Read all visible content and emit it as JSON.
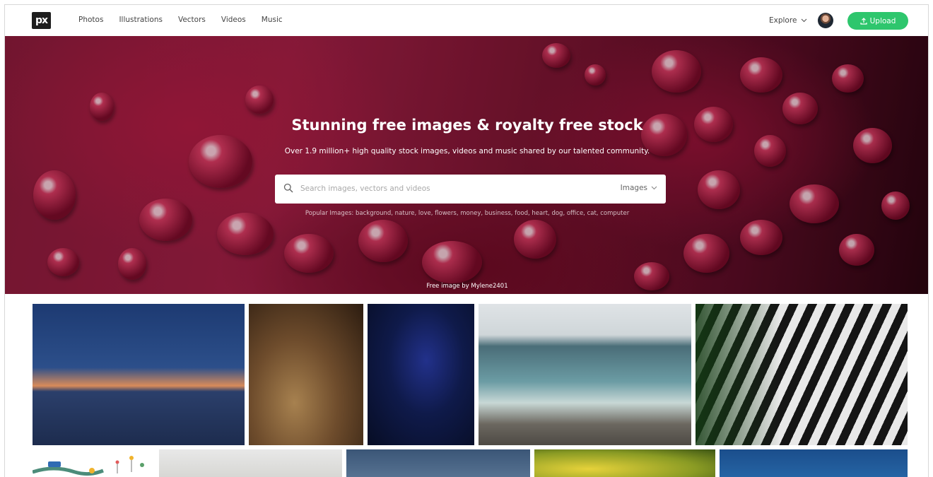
{
  "brand": {
    "logo_text": "px"
  },
  "nav": {
    "items": [
      "Photos",
      "Illustrations",
      "Vectors",
      "Videos",
      "Music"
    ]
  },
  "header": {
    "explore_label": "Explore",
    "upload_label": "Upload"
  },
  "hero": {
    "title": "Stunning free images & royalty free stock",
    "subtitle": "Over 1.9 million+ high quality stock images, videos and music shared by our talented community.",
    "search_placeholder": "Search images, vectors and videos",
    "search_type": "Images",
    "popular": "Popular Images: background, nature, love, flowers, money, business, food, heart, dog, office, cat, computer",
    "credit": "Free image by Mylene2401"
  },
  "colors": {
    "upload": "#2ec66d",
    "hero_base": "#8c1a3a"
  },
  "gallery": {
    "row1": [
      "jetty-sunset-photo",
      "cupcakes-photo",
      "iris-photo",
      "ocean-wave-photo",
      "zebra-photo"
    ],
    "row2": [
      "illustration-photo",
      "mimosa-photo",
      "coast-photo",
      "flower-photo",
      "blue-sea-photo"
    ]
  }
}
